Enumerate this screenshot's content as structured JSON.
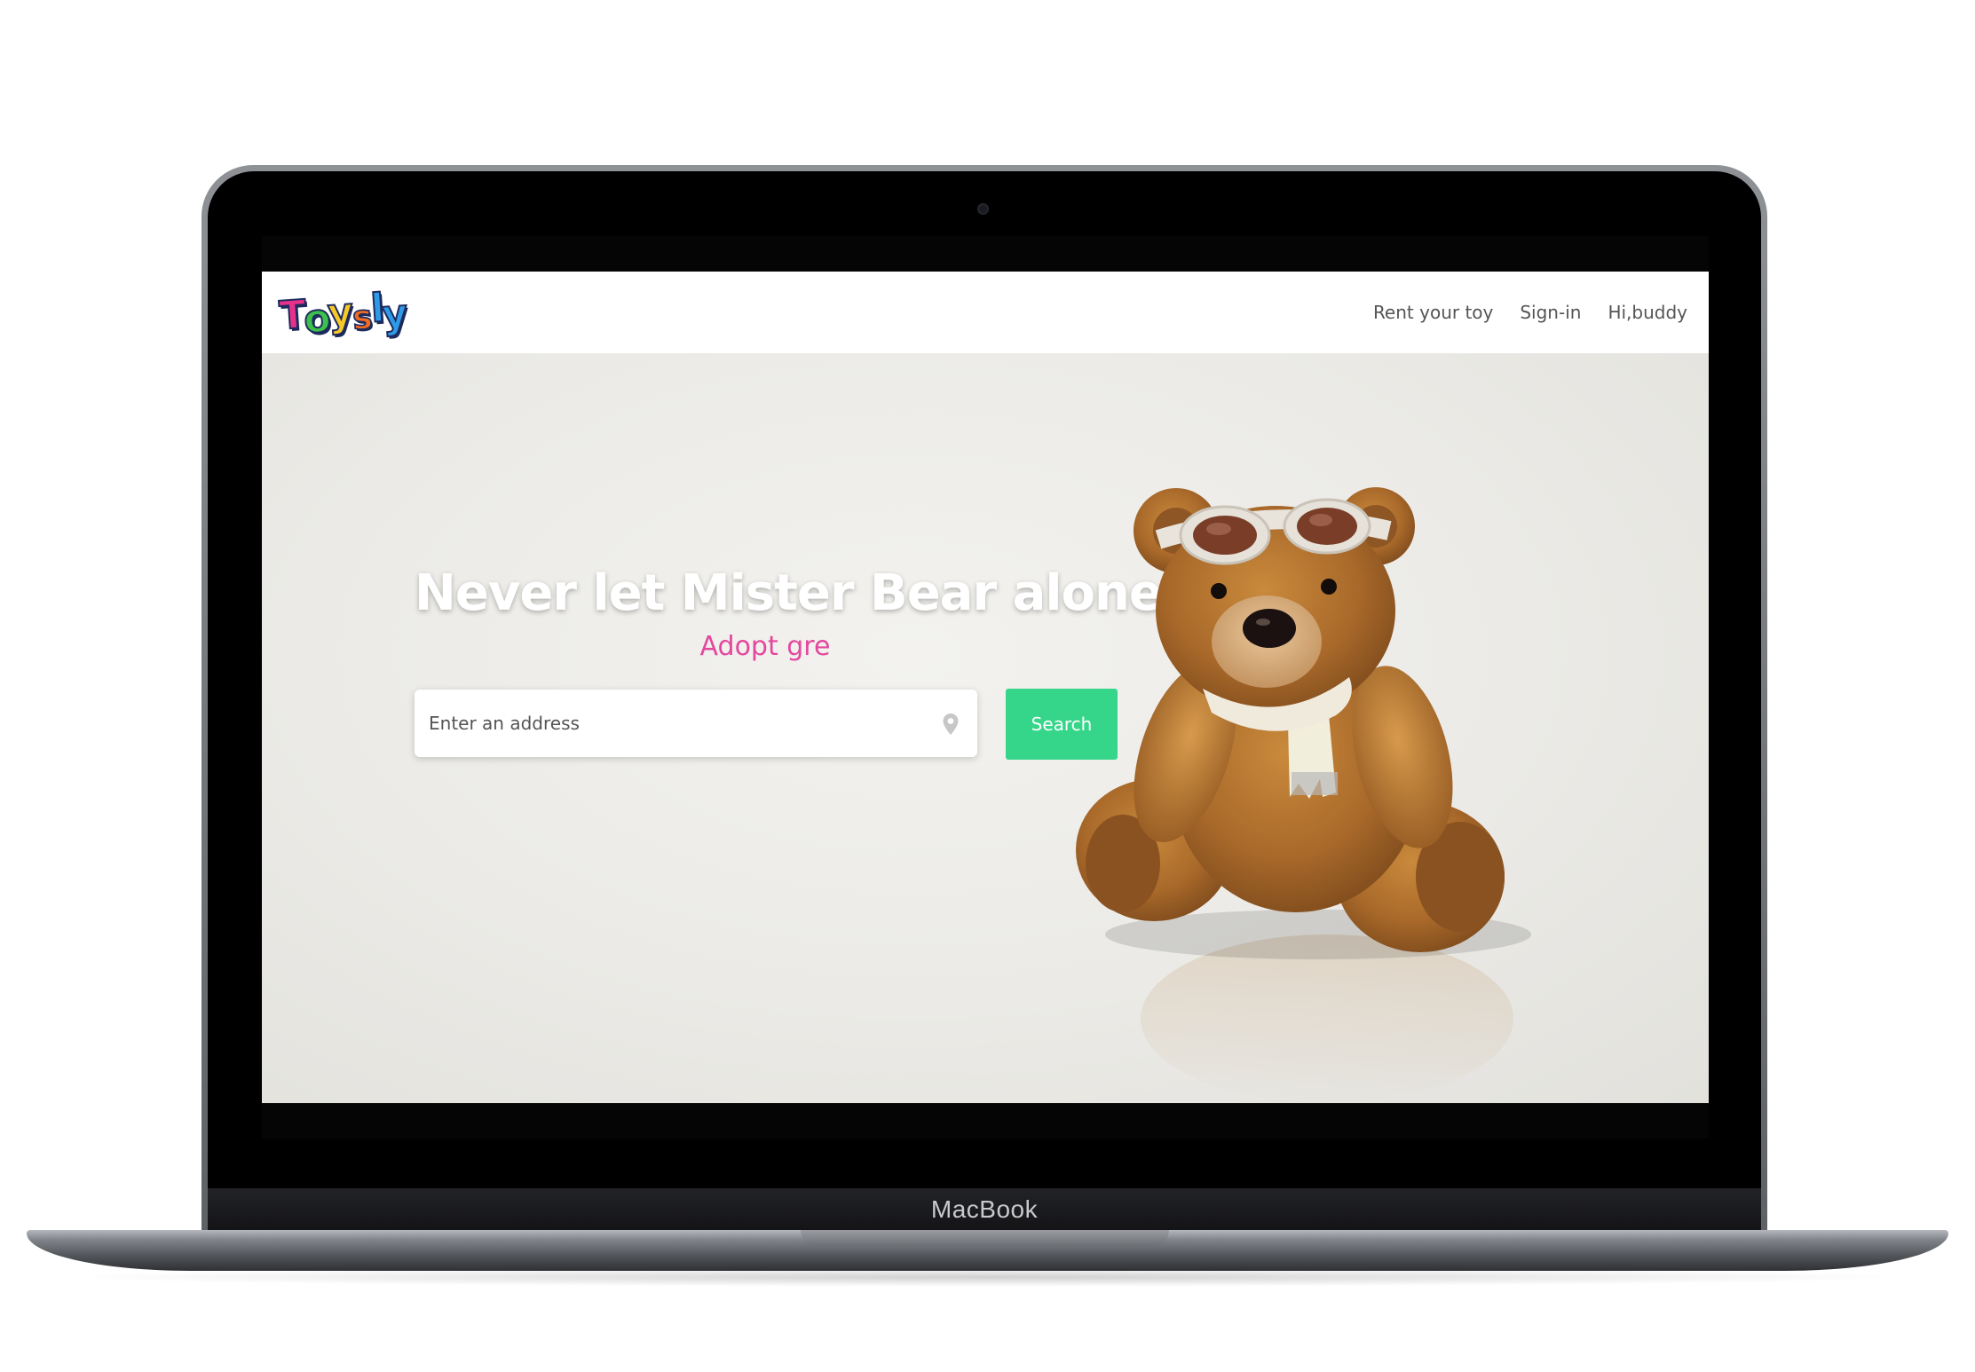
{
  "device": {
    "label": "MacBook"
  },
  "brand": {
    "logo_text": "Toysly"
  },
  "nav": {
    "links": [
      "Rent your toy",
      "Sign-in",
      "Hi,buddy"
    ]
  },
  "hero": {
    "title": "Never let Mister Bear alone!",
    "subtitle": "Adopt gre",
    "image": "teddy-bear-with-aviator-goggles-and-scarf"
  },
  "search": {
    "placeholder": "Enter an address",
    "value": "",
    "button_label": "Search",
    "icon": "map-pin-icon"
  },
  "colors": {
    "accent": "#35d68a",
    "subtitle": "#e4479e",
    "hero_background": "#ebeae6"
  }
}
